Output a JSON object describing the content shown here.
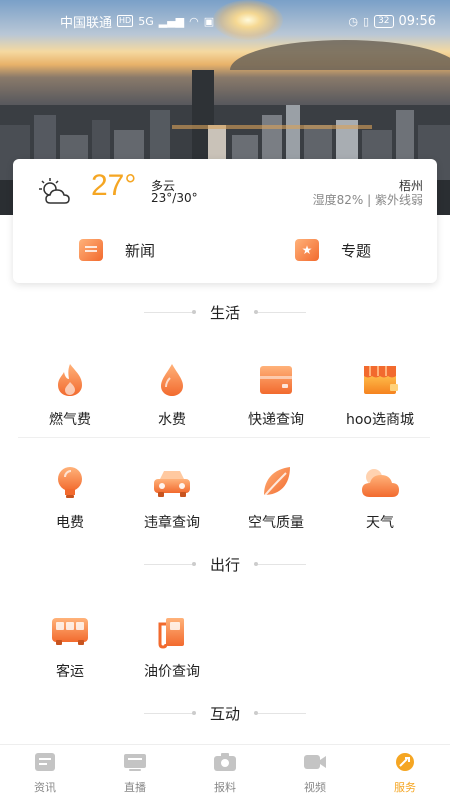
{
  "status_bar": {
    "carrier": "中国联通",
    "hd": "HD",
    "network": "5G",
    "battery": "32",
    "time": "09:56"
  },
  "weather": {
    "temperature": "27°",
    "condition": "多云",
    "range": "23°/30°",
    "city": "梧州",
    "humidity_uv": "湿度82% | 紫外线弱",
    "icon": "partly-cloudy-icon"
  },
  "quick_links": [
    {
      "label": "新闻",
      "icon": "news-icon"
    },
    {
      "label": "专题",
      "icon": "topic-star-icon"
    }
  ],
  "sections": {
    "life": {
      "title": "生活",
      "items": [
        {
          "label": "燃气费",
          "icon": "flame-icon"
        },
        {
          "label": "水费",
          "icon": "water-drop-icon"
        },
        {
          "label": "快递查询",
          "icon": "parcel-icon"
        },
        {
          "label": "hoo选商城",
          "icon": "shop-icon"
        },
        {
          "label": "电费",
          "icon": "lightbulb-icon"
        },
        {
          "label": "违章查询",
          "icon": "car-icon"
        },
        {
          "label": "空气质量",
          "icon": "leaf-icon"
        },
        {
          "label": "天气",
          "icon": "cloud-icon"
        }
      ]
    },
    "travel": {
      "title": "出行",
      "items": [
        {
          "label": "客运",
          "icon": "bus-icon"
        },
        {
          "label": "油价查询",
          "icon": "fuel-pump-icon"
        }
      ]
    },
    "interact": {
      "title": "互动"
    }
  },
  "bottom_nav": [
    {
      "label": "资讯",
      "icon": "news-tab-icon",
      "active": false
    },
    {
      "label": "直播",
      "icon": "live-tab-icon",
      "active": false
    },
    {
      "label": "报料",
      "icon": "camera-tab-icon",
      "active": false
    },
    {
      "label": "视频",
      "icon": "video-tab-icon",
      "active": false
    },
    {
      "label": "服务",
      "icon": "service-tab-icon",
      "active": true
    }
  ],
  "colors": {
    "accent": "#f5a623",
    "icon_gradient_start": "#ffb27a",
    "icon_gradient_end": "#f26a2e",
    "inactive": "#888888"
  }
}
